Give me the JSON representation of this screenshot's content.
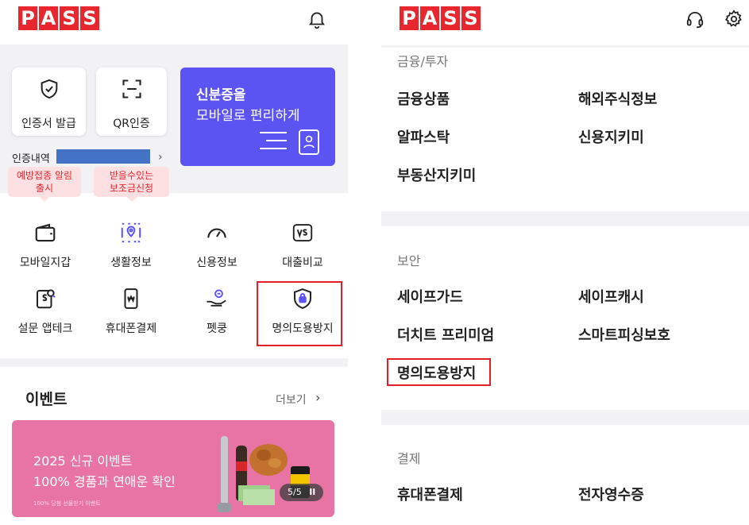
{
  "left": {
    "logo": [
      "P",
      "A",
      "S",
      "S"
    ],
    "icons": {
      "header": "bell-icon"
    },
    "quick_cards": [
      {
        "label": "인증서 발급",
        "icon": "shield-check-icon"
      },
      {
        "label": "QR인증",
        "icon": "qr-scan-icon"
      }
    ],
    "id_banner": {
      "line1": "신분증을",
      "line2": "모바일로 편리하게",
      "icon": "id-card-icon"
    },
    "history_label": "인증내역",
    "bubbles": [
      {
        "line1": "예방접종 알림",
        "line2": "출시"
      },
      {
        "line1": "받을수있는",
        "line2": "보조금신청"
      }
    ],
    "grid": [
      {
        "label": "모바일지갑",
        "icon": "wallet-icon"
      },
      {
        "label": "생활정보",
        "icon": "life-info-icon"
      },
      {
        "label": "신용정보",
        "icon": "gauge-icon"
      },
      {
        "label": "대출비교",
        "icon": "vs-icon"
      },
      {
        "label": "설문 앱테크",
        "icon": "survey-icon"
      },
      {
        "label": "휴대폰결제",
        "icon": "phone-pay-icon"
      },
      {
        "label": "펫쿵",
        "icon": "pet-hand-icon"
      },
      {
        "label": "명의도용방지",
        "icon": "shield-lock-icon"
      }
    ],
    "event": {
      "title": "이벤트",
      "more": "더보기",
      "promo": {
        "line1": "2025 신규 이벤트",
        "line2": "100% 경품과 연애운 확인",
        "fine": "100% 당첨 선물받기 이벤트",
        "pager": "5/5",
        "pause": "II"
      }
    }
  },
  "right": {
    "logo": [
      "P",
      "A",
      "S",
      "S"
    ],
    "icons": {
      "support": "headset-icon",
      "settings": "gear-icon"
    },
    "sections": [
      {
        "title": "금융/투자",
        "items": [
          "금융상품",
          "해외주식정보",
          "알파스탁",
          "신용지키미",
          "부동산지키미"
        ]
      },
      {
        "title": "보안",
        "items": [
          "세이프가드",
          "세이프캐시",
          "더치트 프리미엄",
          "스마트피싱보호",
          "명의도용방지"
        ]
      },
      {
        "title": "결제",
        "items": [
          "휴대폰결제",
          "전자영수증"
        ]
      }
    ]
  },
  "colors": {
    "brand_red": "#e8262e",
    "id_banner": "#5b54f2",
    "promo_pink": "#e874a6",
    "highlight": "#e41e26",
    "icon_purple": "#5b54f2"
  }
}
